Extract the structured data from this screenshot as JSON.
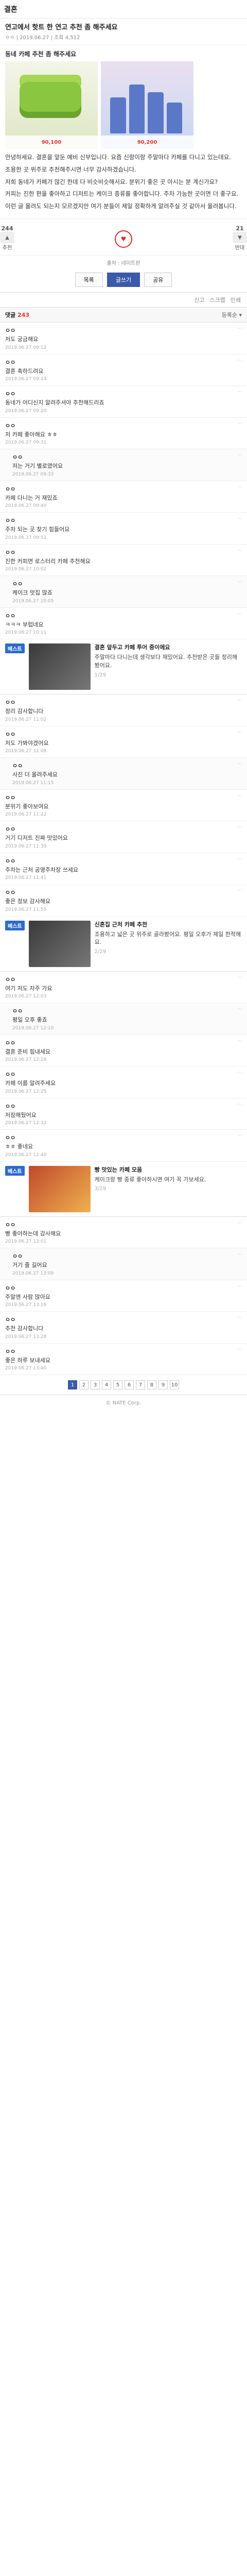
{
  "topbar": {
    "title": "결혼"
  },
  "post": {
    "title": "연고에서 핫트 한 연고 추천 좀 해주세요",
    "meta": "ㅇㅇ | 2019.06.27 | 조회 4,512",
    "subject": "동네 카페 추천 좀 해주세요",
    "price_a": "90,100",
    "price_b": "90,200",
    "paragraphs": [
      "안녕하세요. 결혼을 앞둔 예비 신부입니다. 요즘 신랑이랑 주말마다 카페를 다니고 있는데요.",
      "조용한 곳 위주로 추천해주시면 너무 감사하겠습니다.",
      "저희 동네가 카페가 많긴 한데 다 비슷비슷해서요. 분위기 좋은 곳 아시는 분 계신가요?",
      "커피는 진한 편을 좋아하고 디저트는 케이크 종류를 좋아합니다. 주차 가능한 곳이면 더 좋구요.",
      "이런 글 올려도 되는지 모르겠지만 여기 분들이 제일 정확하게 알려주실 것 같아서 올려봅니다."
    ]
  },
  "votes": {
    "up_label": "추천",
    "up_count": "244",
    "down_label": "반대",
    "down_count": "21"
  },
  "source_line": "출처 : 네이트판",
  "actions": {
    "list": "목록",
    "write": "글쓰기",
    "share": "공유"
  },
  "iconrow": {
    "report": "신고",
    "scrap": "스크랩",
    "print": "인쇄"
  },
  "comments_head": {
    "label": "댓글",
    "count": "243",
    "sort": "등록순 ▾"
  },
  "comments": [
    {
      "nick": "ㅇㅇ",
      "txt": "저도 궁금해요",
      "date": "2019.06.27 09:12",
      "reply": false
    },
    {
      "nick": "ㅇㅇ",
      "txt": "결혼 축하드려요",
      "date": "2019.06.27 09:14",
      "reply": false
    },
    {
      "nick": "ㅇㅇ",
      "txt": "동네가 어디신지 알려주셔야 추천해드리죠",
      "date": "2019.06.27 09:20",
      "reply": false
    },
    {
      "nick": "ㅇㅇ",
      "txt": "저 카페 좋아해요 ㅎㅎ",
      "date": "2019.06.27 09:31",
      "reply": false
    },
    {
      "nick": "ㅇㅇ",
      "txt": "저는 거기 별로였어요",
      "date": "2019.06.27 09:33",
      "reply": true
    },
    {
      "nick": "ㅇㅇ",
      "txt": "카페 다니는 거 재밌죠",
      "date": "2019.06.27 09:40",
      "reply": false
    },
    {
      "nick": "ㅇㅇ",
      "txt": "주차 되는 곳 찾기 힘들어요",
      "date": "2019.06.27 09:51",
      "reply": false
    },
    {
      "nick": "ㅇㅇ",
      "txt": "진한 커피면 로스터리 카페 추천해요",
      "date": "2019.06.27 10:02",
      "reply": false
    },
    {
      "nick": "ㅇㅇ",
      "txt": "케이크 맛집 많죠",
      "date": "2019.06.27 10:05",
      "reply": true
    },
    {
      "nick": "ㅇㅇ",
      "txt": "ㅋㅋㅋ 부럽네요",
      "date": "2019.06.27 10:11",
      "reply": false
    }
  ],
  "best1": {
    "tag": "베스트",
    "title": "결혼 앞두고 카페 투어 중이에요",
    "desc": "주말마다 다니는데 생각보다 재밌어요. 추천받은 곳들 정리해봤어요.",
    "page": "1/29"
  },
  "comments2": [
    {
      "nick": "ㅇㅇ",
      "txt": "정리 감사합니다",
      "date": "2019.06.27 11:02",
      "reply": false
    },
    {
      "nick": "ㅇㅇ",
      "txt": "저도 가봐야겠어요",
      "date": "2019.06.27 11:08",
      "reply": false
    },
    {
      "nick": "ㅇㅇ",
      "txt": "사진 더 올려주세요",
      "date": "2019.06.27 11:15",
      "reply": true
    },
    {
      "nick": "ㅇㅇ",
      "txt": "분위기 좋아보여요",
      "date": "2019.06.27 11:22",
      "reply": false
    },
    {
      "nick": "ㅇㅇ",
      "txt": "거기 디저트 진짜 맛있어요",
      "date": "2019.06.27 11:30",
      "reply": false
    },
    {
      "nick": "ㅇㅇ",
      "txt": "주차는 근처 공영주차장 쓰세요",
      "date": "2019.06.27 11:41",
      "reply": false
    },
    {
      "nick": "ㅇㅇ",
      "txt": "좋은 정보 감사해요",
      "date": "2019.06.27 11:55",
      "reply": false
    }
  ],
  "best2": {
    "tag": "베스트",
    "title": "신혼집 근처 카페 추천",
    "desc": "조용하고 넓은 곳 위주로 골라봤어요. 평일 오후가 제일 한적해요.",
    "page": "2/29"
  },
  "comments3": [
    {
      "nick": "ㅇㅇ",
      "txt": "여기 저도 자주 가요",
      "date": "2019.06.27 12:03",
      "reply": false
    },
    {
      "nick": "ㅇㅇ",
      "txt": "평일 오후 좋죠",
      "date": "2019.06.27 12:10",
      "reply": true
    },
    {
      "nick": "ㅇㅇ",
      "txt": "결혼 준비 힘내세요",
      "date": "2019.06.27 12:18",
      "reply": false
    },
    {
      "nick": "ㅇㅇ",
      "txt": "카페 이름 알려주세요",
      "date": "2019.06.27 12:25",
      "reply": false
    },
    {
      "nick": "ㅇㅇ",
      "txt": "저장해뒀어요",
      "date": "2019.06.27 12:32",
      "reply": false
    },
    {
      "nick": "ㅇㅇ",
      "txt": "ㅎㅎ 좋네요",
      "date": "2019.06.27 12:40",
      "reply": false
    }
  ],
  "best3": {
    "tag": "베스트",
    "title": "빵 맛있는 카페 모음",
    "desc": "케이크랑 빵 종류 좋아하시면 여기 꼭 가보세요.",
    "page": "3/29"
  },
  "comments4": [
    {
      "nick": "ㅇㅇ",
      "txt": "빵 좋아하는데 감사해요",
      "date": "2019.06.27 13:01",
      "reply": false
    },
    {
      "nick": "ㅇㅇ",
      "txt": "거기 줄 길어요",
      "date": "2019.06.27 13:09",
      "reply": true
    },
    {
      "nick": "ㅇㅇ",
      "txt": "주말엔 사람 많아요",
      "date": "2019.06.27 13:16",
      "reply": false
    },
    {
      "nick": "ㅇㅇ",
      "txt": "추천 감사합니다",
      "date": "2019.06.27 13:28",
      "reply": false
    },
    {
      "nick": "ㅇㅇ",
      "txt": "좋은 하루 보내세요",
      "date": "2019.06.27 13:40",
      "reply": false
    }
  ],
  "pager": [
    "1",
    "2",
    "3",
    "4",
    "5",
    "6",
    "7",
    "8",
    "9",
    "10"
  ],
  "footer": "© NATE Corp."
}
